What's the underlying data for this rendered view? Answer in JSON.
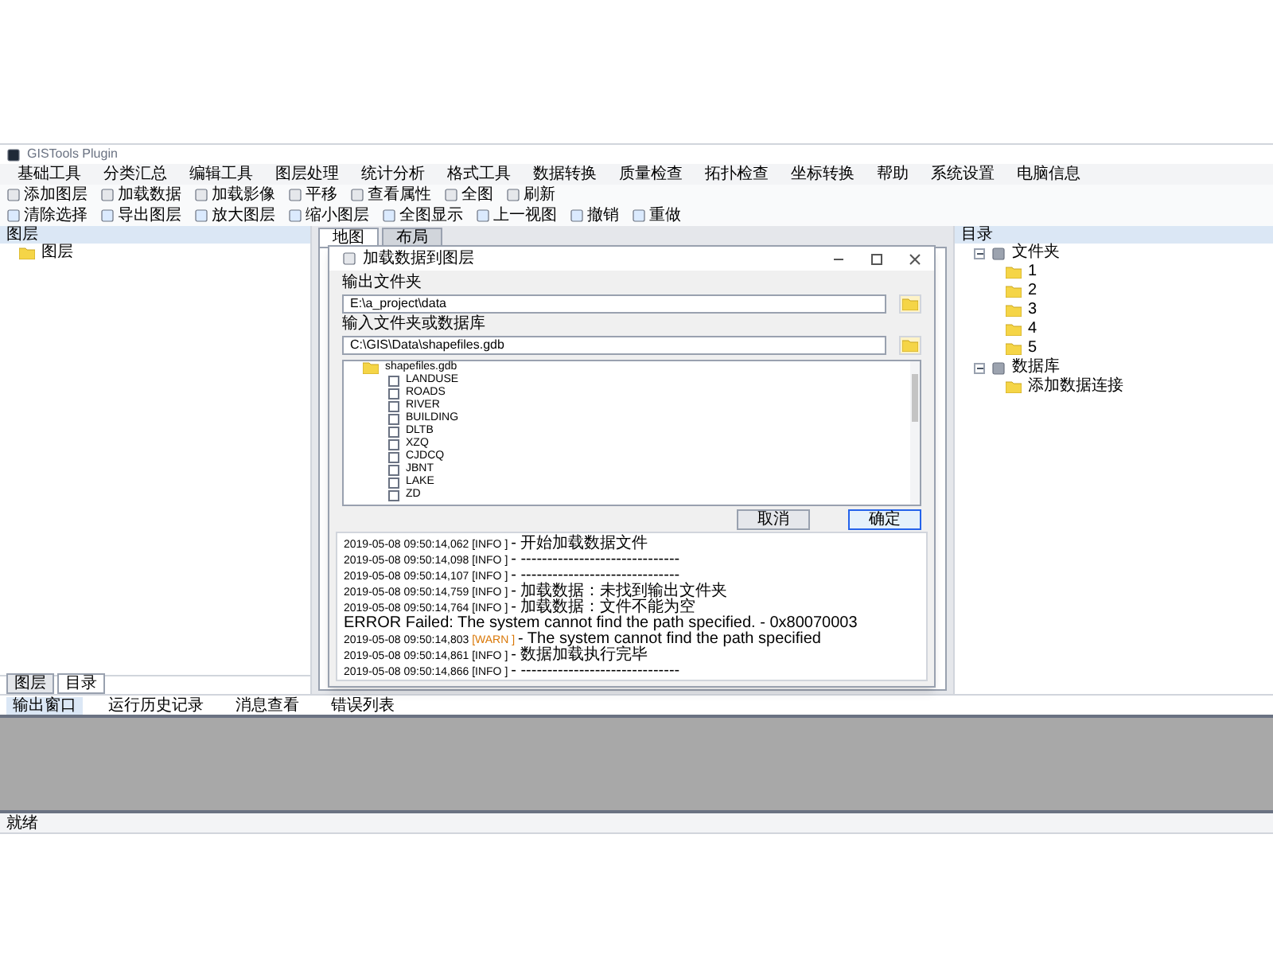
{
  "window": {
    "title": "GISTools Plugin"
  },
  "menu": [
    "基础工具",
    "分类汇总",
    "编辑工具",
    "图层处理",
    "统计分析",
    "格式工具",
    "数据转换",
    "质量检查",
    "拓扑检查",
    "坐标转换",
    "帮助",
    "系统设置",
    "电脑信息"
  ],
  "toolbar_1": [
    "添加图层",
    "加载数据",
    "加载影像",
    "平移",
    "查看属性",
    "全图",
    "刷新"
  ],
  "toolbar_2": [
    "清除选择",
    "导出图层",
    "放大图层",
    "缩小图层",
    "全图显示",
    "上一视图",
    "撤销",
    "重做"
  ],
  "left_panel": {
    "title": "图层",
    "items": [
      "图层"
    ],
    "tabs": [
      {
        "label": "图层",
        "selected": false
      },
      {
        "label": "目录",
        "selected": true
      }
    ]
  },
  "center_tabs": [
    {
      "label": "地图",
      "selected": true
    },
    {
      "label": "布局",
      "selected": false
    }
  ],
  "right_panel": {
    "title": "目录",
    "tree": [
      {
        "label": "文件夹",
        "expanded": true,
        "children": [
          {
            "label": "1"
          },
          {
            "label": "2"
          },
          {
            "label": "3"
          },
          {
            "label": "4"
          },
          {
            "label": "5"
          }
        ]
      },
      {
        "label": "数据库",
        "expanded": true,
        "children": [
          {
            "label": "添加数据连接"
          }
        ]
      }
    ]
  },
  "dialog": {
    "title": "加载数据到图层",
    "output_label": "输出文件夹",
    "output_value": "E:\\a_project\\data",
    "input_label": "输入文件夹或数据库",
    "input_value": "C:\\GIS\\Data\\shapefiles.gdb",
    "tree": {
      "label": "shapefiles.gdb",
      "children": [
        {
          "label": "LANDUSE",
          "checked": false
        },
        {
          "label": "ROADS",
          "checked": false
        },
        {
          "label": "RIVER",
          "checked": false
        },
        {
          "label": "BUILDING",
          "checked": false
        },
        {
          "label": "DLTB",
          "checked": false
        },
        {
          "label": "XZQ",
          "checked": false
        },
        {
          "label": "CJDCQ",
          "checked": false
        },
        {
          "label": "JBNT",
          "checked": false
        },
        {
          "label": "LAKE",
          "checked": false
        },
        {
          "label": "ZD",
          "checked": false
        }
      ]
    },
    "buttons": [
      {
        "label": "取消",
        "kind": "default"
      },
      {
        "label": "确定",
        "kind": "primary"
      }
    ],
    "log": [
      {
        "time": "2019-05-08 09:50:14,062",
        "tag": "[INFO ]",
        "kind": "info",
        "message": "- 开始加载数据文件"
      },
      {
        "time": "2019-05-08 09:50:14,098",
        "tag": "[INFO ]",
        "kind": "info",
        "message": "- ------------------------------"
      },
      {
        "time": "2019-05-08 09:50:14,107",
        "tag": "[INFO ]",
        "kind": "info",
        "message": "- ------------------------------"
      },
      {
        "time": "2019-05-08 09:50:14,759",
        "tag": "[INFO ]",
        "kind": "info",
        "message": "- 加载数据：未找到输出文件夹"
      },
      {
        "time": "2019-05-08 09:50:14,764",
        "tag": "[INFO ]",
        "kind": "info",
        "message": "- 加载数据：文件不能为空"
      },
      {
        "kind": "plain",
        "message": "ERROR Failed: The system cannot find the path specified. - 0x80070003"
      },
      {
        "time": "2019-05-08 09:50:14,803",
        "tag": "[WARN ]",
        "kind": "warn",
        "message": "- The system cannot find the path specified"
      },
      {
        "time": "2019-05-08 09:50:14,861",
        "tag": "[INFO ]",
        "kind": "info",
        "message": "- 数据加载执行完毕"
      },
      {
        "time": "2019-05-08 09:50:14,866",
        "tag": "[INFO ]",
        "kind": "info",
        "message": "- ------------------------------"
      }
    ]
  },
  "bottom_tabs": [
    {
      "label": "输出窗口",
      "selected": true
    },
    {
      "label": "运行历史记录",
      "selected": false
    },
    {
      "label": "消息查看",
      "selected": false
    },
    {
      "label": "错误列表",
      "selected": false
    }
  ],
  "status_bar": "就绪"
}
